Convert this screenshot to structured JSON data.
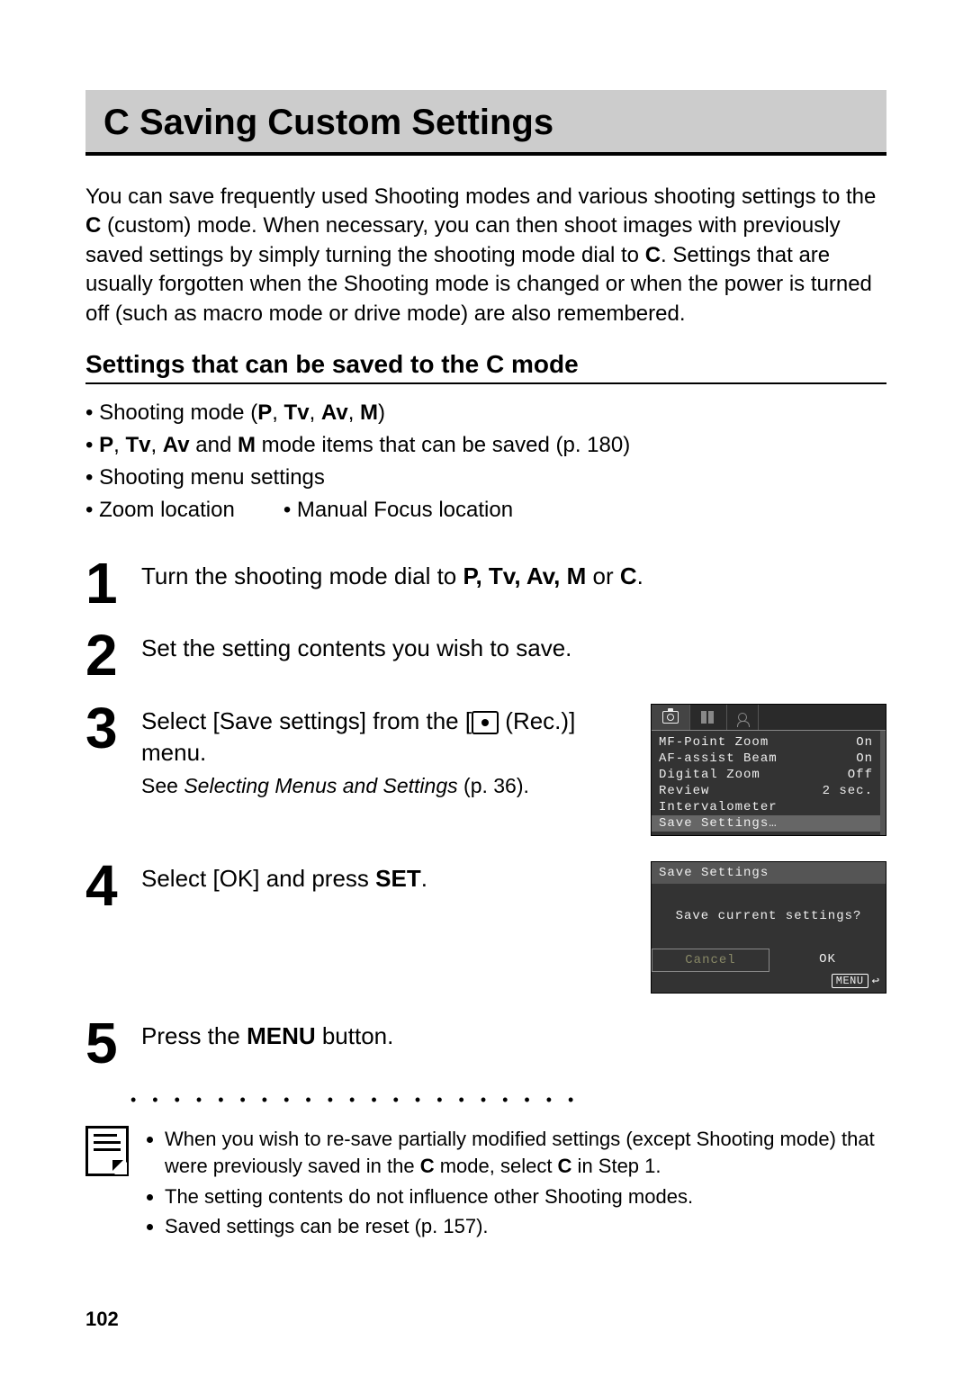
{
  "title": "C Saving Custom Settings",
  "intro_html": "You can save frequently used Shooting modes and various shooting settings to the <b>C</b> (custom) mode. When necessary, you can then shoot images with previously saved settings by simply turning the shooting mode dial to <b>C</b>. Settings that are usually forgotten when the Shooting mode is changed or when the power is turned off (such as macro mode or drive mode) are also remembered.",
  "section_heading": "Settings that can be saved to the C mode",
  "bullets": {
    "b1": "Shooting mode (<b>P</b>, <b>Tv</b>, <b>Av</b>, <b>M</b>)",
    "b2": "<b>P</b>, <b>Tv</b>, <b>Av</b> and <b>M</b> mode items that can be saved (p. 180)",
    "b3": "Shooting menu settings",
    "b4": "Zoom location",
    "b5": "Manual Focus location"
  },
  "steps": {
    "s1": "Turn the shooting mode dial to <b>P, Tv, Av, M</b> or <b>C</b>.",
    "s2": "Set the setting contents you wish to save.",
    "s3a": "Select [Save settings] from the [",
    "s3b": " (Rec.)] menu.",
    "s3sub": "See <i>Selecting Menus and Settings</i> (p. 36).",
    "s4": "Select [OK] and press <b>SET</b>.",
    "s5": "Press the <b>MENU</b> button."
  },
  "menu_screen": {
    "items": [
      {
        "label": "MF-Point Zoom",
        "value": "On"
      },
      {
        "label": "AF-assist Beam",
        "value": "On"
      },
      {
        "label": "Digital Zoom",
        "value": "Off"
      },
      {
        "label": "Review",
        "value": "2 sec."
      },
      {
        "label": "Intervalometer",
        "value": ""
      },
      {
        "label": "Save Settings…",
        "value": "",
        "selected": true
      }
    ]
  },
  "dialog_screen": {
    "header": "Save Settings",
    "message": "Save current settings?",
    "cancel": "Cancel",
    "ok": "OK",
    "menu_label": "MENU"
  },
  "notes": {
    "n1": "When you wish to re-save partially modified settings (except Shooting mode) that were previously saved in the <b>C</b> mode, select <b>C</b> in Step 1.",
    "n2": "The setting contents do not influence other Shooting modes.",
    "n3": "Saved settings can be reset (p. 157)."
  },
  "page_number": "102"
}
